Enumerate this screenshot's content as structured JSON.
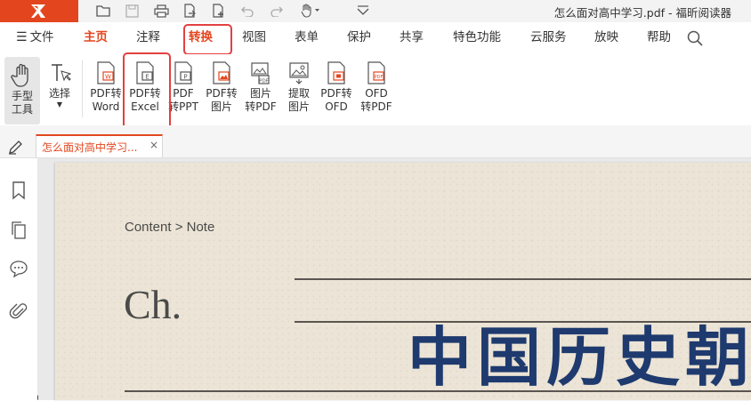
{
  "titlebar": {
    "window_title": "怎么面对高中学习.pdf - 福昕阅读器",
    "quick_access": [
      "open-folder-icon",
      "save-icon",
      "print-icon",
      "export-icon",
      "new-file-icon",
      "undo-icon",
      "redo-icon",
      "hand-dropdown-icon",
      "customize-dropdown-icon"
    ]
  },
  "menubar": {
    "file_label": "文件",
    "items": [
      "主页",
      "注释",
      "转换",
      "视图",
      "表单",
      "保护",
      "共享",
      "特色功能",
      "云服务",
      "放映",
      "帮助"
    ]
  },
  "ribbon": {
    "hand_tool": "手型\n工具",
    "select": "选择",
    "buttons": [
      {
        "line1": "PDF转",
        "line2": "Word"
      },
      {
        "line1": "PDF转",
        "line2": "Excel"
      },
      {
        "line1": "PDF",
        "line2": "转PPT"
      },
      {
        "line1": "PDF转",
        "line2": "图片"
      },
      {
        "line1": "图片",
        "line2": "转PDF"
      },
      {
        "line1": "提取",
        "line2": "图片"
      },
      {
        "line1": "PDF转",
        "line2": "OFD"
      },
      {
        "line1": "OFD",
        "line2": "转PDF"
      }
    ]
  },
  "tabs": {
    "doc_tab_label": "怎么面对高中学习...",
    "close": "×"
  },
  "document": {
    "breadcrumb": "Content > Note",
    "chapter": "Ch.",
    "big_title": "中国历史朝"
  },
  "colors": {
    "accent": "#e3461e",
    "highlight_box": "#e34040",
    "title_blue": "#1e3a6e",
    "paper": "#ece4d6"
  }
}
